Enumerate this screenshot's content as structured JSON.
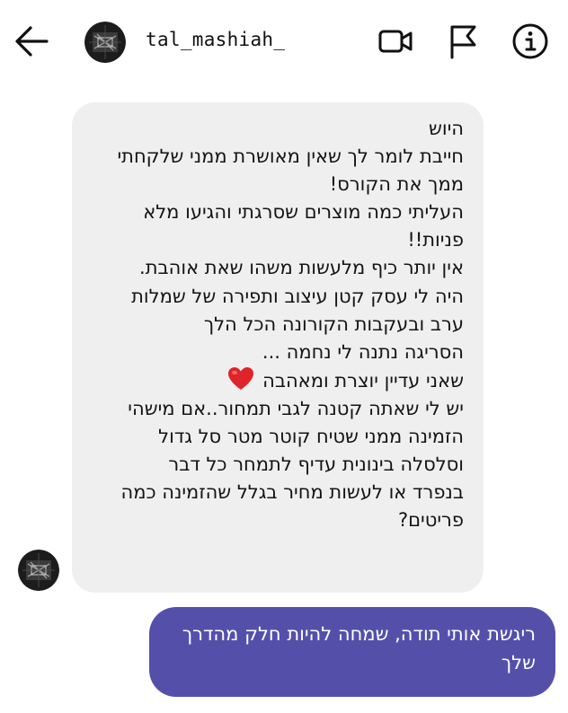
{
  "header": {
    "username": "tal_mashiah_",
    "back_icon": "back-arrow-icon",
    "video_icon": "video-call-icon",
    "flag_icon": "flag-icon",
    "info_icon": "info-icon"
  },
  "messages": {
    "incoming": {
      "lines": [
        "היוש",
        "חייבת לומר לך שאין מאושרת ממני שלקחתי",
        "ממך את הקורס!",
        "העליתי כמה מוצרים שסרגתי והגיעו מלא",
        "פניות!!",
        "אין יותר כיף מלעשות משהו שאת אוהבת.",
        "היה לי עסק קטן עיצוב ותפירה של שמלות",
        "ערב ובעקבות הקורונה הכל הלך",
        "הסריגה נתנה לי נחמה ...",
        "שאני עדיין יוצרת ומאהבה",
        "יש לי שאתה קטנה לגבי תמחור..אם מישהי",
        "הזמינה ממני שטיח קוטר מטר סל גדול",
        "וסלסלה בינונית עדיף לתמחר כל דבר",
        "בנפרד או לעשות מחיר בגלל שהזמינה כמה",
        "פריטים?"
      ],
      "emoji": "heart-icon"
    },
    "outgoing": {
      "lines": [
        "ריגשת אותי תודה, שמחה להיות חלק מהדרך",
        "שלך"
      ]
    }
  },
  "colors": {
    "incoming_bubble": "#efefef",
    "outgoing_bubble": "#5450aa",
    "heart": "#e0242c"
  }
}
